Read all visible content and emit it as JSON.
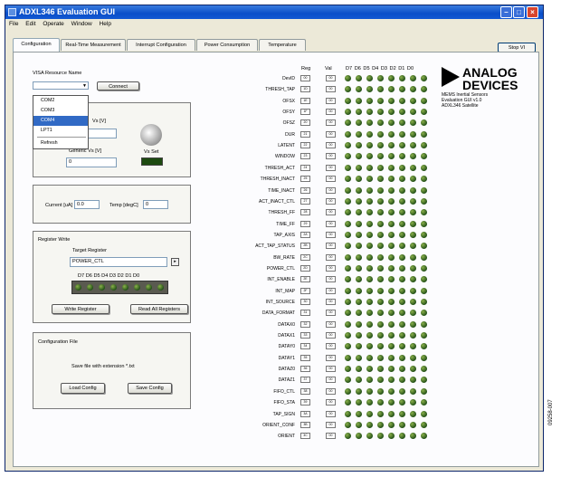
{
  "window": {
    "title": "ADXL346 Evaluation GUI"
  },
  "menu": [
    "File",
    "Edit",
    "Operate",
    "Window",
    "Help"
  ],
  "tabs": [
    "Configuration",
    "Real-Time Measurement",
    "Interrupt Configuration",
    "Power Consumption",
    "Temperature"
  ],
  "stop_vi": "Stop VI",
  "visa": {
    "label": "VISA Resource Name",
    "selected": "",
    "connect_button": "Connect",
    "options": [
      "COM2",
      "COM3",
      "COM4",
      "LPT1",
      "Refresh"
    ],
    "selected_option": "COM4"
  },
  "supply": {
    "vs_label": "Vs [V]",
    "generic_vs_label": "Generic Vs [V]",
    "generic_vs_value": "0",
    "vs_set_label": "Vs Set"
  },
  "measure": {
    "current_label": "Current [uA]",
    "current_value": "0.0",
    "temp_label": "Temp [degC]",
    "temp_value": "0"
  },
  "register_write": {
    "title": "Register Write",
    "target_label": "Target Register",
    "target_value": "POWER_CTL",
    "bits": [
      "D7",
      "D6",
      "D5",
      "D4",
      "D3",
      "D2",
      "D1",
      "D0"
    ],
    "write_button": "Write Register",
    "read_all_button": "Read All Registers"
  },
  "config_file": {
    "title": "Configuration File",
    "message": "Save file with extension *.txt",
    "load_button": "Load Config",
    "save_button": "Save Config"
  },
  "register_table": {
    "reg_header": "Reg",
    "val_header": "Val",
    "bit_header": "D7 D6 D5 D4 D3 D2 D1 D0",
    "rows": [
      {
        "name": "DevID",
        "reg": "00",
        "val": "00"
      },
      {
        "name": "THRESH_TAP",
        "reg": "1D",
        "val": "00"
      },
      {
        "name": "OFSX",
        "reg": "1E",
        "val": "00"
      },
      {
        "name": "OFSY",
        "reg": "1F",
        "val": "00"
      },
      {
        "name": "OFSZ",
        "reg": "20",
        "val": "00"
      },
      {
        "name": "DUR",
        "reg": "21",
        "val": "00"
      },
      {
        "name": "LATENT",
        "reg": "22",
        "val": "00"
      },
      {
        "name": "WINDOW",
        "reg": "23",
        "val": "00"
      },
      {
        "name": "THRESH_ACT",
        "reg": "24",
        "val": "00"
      },
      {
        "name": "THRESH_INACT",
        "reg": "25",
        "val": "00"
      },
      {
        "name": "TIME_INACT",
        "reg": "26",
        "val": "00"
      },
      {
        "name": "ACT_INACT_CTL",
        "reg": "27",
        "val": "00"
      },
      {
        "name": "THRESH_FF",
        "reg": "28",
        "val": "00"
      },
      {
        "name": "TIME_FF",
        "reg": "29",
        "val": "00"
      },
      {
        "name": "TAP_AXIS",
        "reg": "2A",
        "val": "00"
      },
      {
        "name": "ACT_TAP_STATUS",
        "reg": "2B",
        "val": "00"
      },
      {
        "name": "BW_RATE",
        "reg": "2C",
        "val": "00"
      },
      {
        "name": "POWER_CTL",
        "reg": "2D",
        "val": "00"
      },
      {
        "name": "INT_ENABLE",
        "reg": "2E",
        "val": "00"
      },
      {
        "name": "INT_MAP",
        "reg": "2F",
        "val": "00"
      },
      {
        "name": "INT_SOURCE",
        "reg": "30",
        "val": "00"
      },
      {
        "name": "DATA_FORMAT",
        "reg": "31",
        "val": "00"
      },
      {
        "name": "DATAX0",
        "reg": "32",
        "val": "00"
      },
      {
        "name": "DATAX1",
        "reg": "33",
        "val": "00"
      },
      {
        "name": "DATAY0",
        "reg": "34",
        "val": "00"
      },
      {
        "name": "DATAY1",
        "reg": "35",
        "val": "00"
      },
      {
        "name": "DATAZ0",
        "reg": "36",
        "val": "00"
      },
      {
        "name": "DATAZ1",
        "reg": "37",
        "val": "00"
      },
      {
        "name": "FIFO_CTL",
        "reg": "38",
        "val": "00"
      },
      {
        "name": "FIFO_STA",
        "reg": "39",
        "val": "00"
      },
      {
        "name": "TAP_SIGN",
        "reg": "3A",
        "val": "00"
      },
      {
        "name": "ORIENT_CONF",
        "reg": "3B",
        "val": "00"
      },
      {
        "name": "ORIENT",
        "reg": "3C",
        "val": "00"
      }
    ]
  },
  "logo": {
    "line1": "ANALOG",
    "line2": "DEVICES"
  },
  "info": [
    "MEMS Inertial Sensors",
    "Evaluation GUI v1.0",
    "ADXL346 Satellite"
  ],
  "figure_id": "09258-007"
}
